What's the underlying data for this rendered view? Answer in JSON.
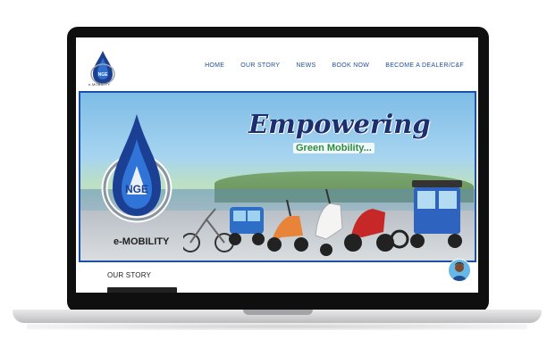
{
  "brand": {
    "logo_acronym": "NGE",
    "logo_caption": "e-MOBILITY"
  },
  "nav": {
    "items": [
      {
        "label": "HOME"
      },
      {
        "label": "OUR STORY"
      },
      {
        "label": "NEWS"
      },
      {
        "label": "BOOK NOW"
      },
      {
        "label": "BECOME A DEALER/C&F"
      }
    ]
  },
  "hero": {
    "headline": "Empowering",
    "subheadline": "Green Mobility...",
    "logo_acronym": "NGE",
    "logo_caption": "e-MOBILITY"
  },
  "content": {
    "section_title": "OUR STORY"
  },
  "colors": {
    "brand_blue": "#1d2f70",
    "nav_blue": "#1f4f93",
    "accent_green": "#2d8f3a",
    "frame_blue": "#1c4fa6"
  },
  "icons": [
    "nge-logo-icon",
    "chat-avatar-icon"
  ]
}
